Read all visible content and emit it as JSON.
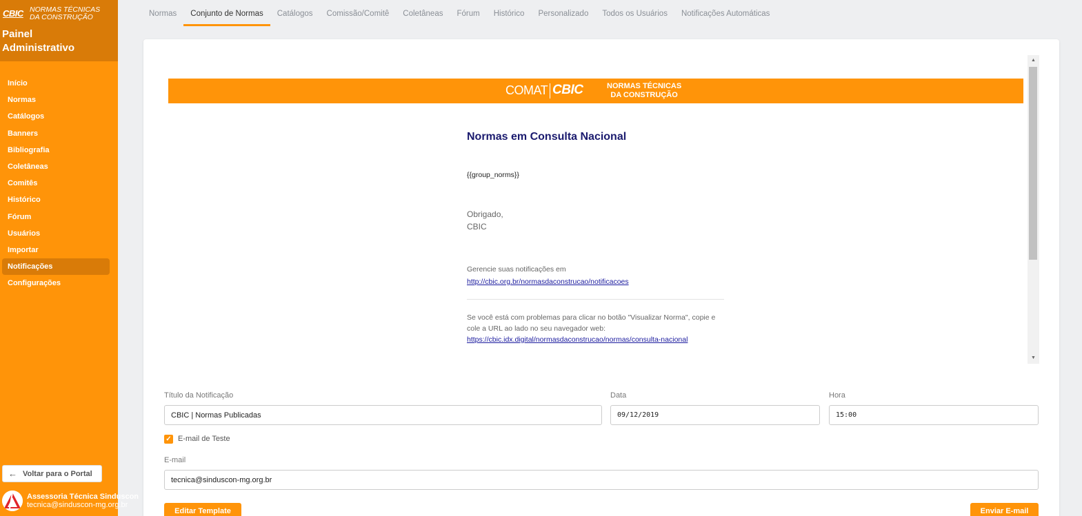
{
  "sidebar": {
    "brand_logo": "CBIC",
    "brand_subtitle_line1": "NORMAS TÉCNICAS",
    "brand_subtitle_line2": "DA CONSTRUÇÃO",
    "panel_title_line1": "Painel",
    "panel_title_line2": "Administrativo",
    "items": [
      {
        "label": "Início"
      },
      {
        "label": "Normas"
      },
      {
        "label": "Catálogos"
      },
      {
        "label": "Banners"
      },
      {
        "label": "Bibliografia"
      },
      {
        "label": "Coletâneas"
      },
      {
        "label": "Comitês"
      },
      {
        "label": "Histórico"
      },
      {
        "label": "Fórum"
      },
      {
        "label": "Usuários"
      },
      {
        "label": "Importar"
      },
      {
        "label": "Notificações",
        "active": true
      },
      {
        "label": "Configurações"
      }
    ],
    "back_button": "Voltar para o Portal",
    "user_name": "Assessoria Técnica Sinduscon",
    "user_email": "tecnica@sinduscon-mg.org.br"
  },
  "tabs": [
    {
      "label": "Normas"
    },
    {
      "label": "Conjunto de Normas",
      "active": true
    },
    {
      "label": "Catálogos"
    },
    {
      "label": "Comissão/Comitê"
    },
    {
      "label": "Coletâneas"
    },
    {
      "label": "Fórum"
    },
    {
      "label": "Histórico"
    },
    {
      "label": "Personalizado"
    },
    {
      "label": "Todos os Usuários"
    },
    {
      "label": "Notificações Automáticas"
    }
  ],
  "email_preview": {
    "banner_comat": "COMAT",
    "banner_cbic": "CBIC",
    "banner_sub_line1": "NORMAS TÉCNICAS",
    "banner_sub_line2": "DA CONSTRUÇÃO",
    "title": "Normas em Consulta Nacional",
    "placeholder": "{{group_norms}}",
    "thanks_line1": "Obrigado,",
    "thanks_line2": "CBIC",
    "manage_text": "Gerencie suas notificações em",
    "manage_link": "http://cbic.org.br/normasdaconstrucao/notificacoes",
    "help_text": "Se você está com problemas para clicar no botão \"Visualizar Norma\", copie e cole a URL ao lado no seu navegador web:",
    "help_link": "https://cbic.idx.digital/normasdaconstrucao/normas/consulta-nacional"
  },
  "form": {
    "title_label": "Título da Notificação",
    "title_value": "CBIC | Normas Publicadas",
    "date_label": "Data",
    "date_value": "09/12/2019",
    "time_label": "Hora",
    "time_value": "15:00",
    "test_email_label": "E-mail de Teste",
    "test_email_checked": true,
    "email_label": "E-mail",
    "email_value": "tecnica@sinduscon-mg.org.br",
    "edit_template_button": "Editar Template",
    "send_email_button": "Enviar E-mail"
  },
  "colors": {
    "accent": "#ff9409",
    "accent_dark": "#d97b08",
    "title_navy": "#1a1a6e"
  }
}
